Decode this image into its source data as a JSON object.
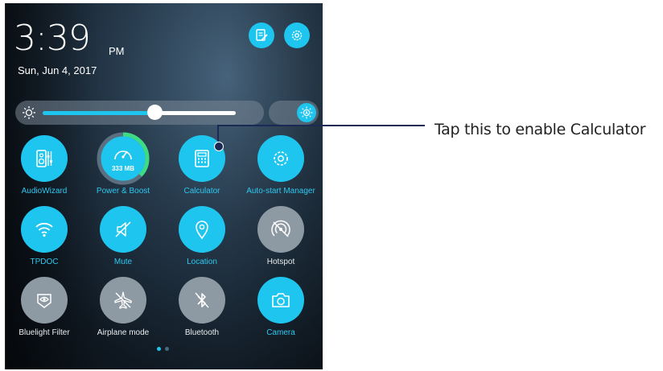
{
  "status": {
    "time": "3:39",
    "ampm": "PM",
    "date": "Sun, Jun 4, 2017"
  },
  "top_buttons": [
    {
      "name": "edit-notes-icon"
    },
    {
      "name": "settings-gear-icon"
    }
  ],
  "brightness": {
    "level": 0.58,
    "auto_icon": "auto-brightness-icon",
    "icon": "sun-icon"
  },
  "tiles": [
    {
      "label": "AudioWizard",
      "active": true,
      "icon": "audiowizard-icon"
    },
    {
      "label": "Power & Boost",
      "active": true,
      "icon": "speedometer-icon",
      "badge": "333 MB"
    },
    {
      "label": "Calculator",
      "active": true,
      "icon": "calculator-icon"
    },
    {
      "label": "Auto-start Manager",
      "active": true,
      "icon": "gear-icon"
    },
    {
      "label": "TPDOC",
      "active": true,
      "icon": "wifi-icon"
    },
    {
      "label": "Mute",
      "active": true,
      "icon": "mute-icon"
    },
    {
      "label": "Location",
      "active": true,
      "icon": "location-pin-icon"
    },
    {
      "label": "Hotspot",
      "active": false,
      "icon": "hotspot-icon"
    },
    {
      "label": "Bluelight Filter",
      "active": false,
      "icon": "eye-icon"
    },
    {
      "label": "Airplane mode",
      "active": false,
      "icon": "airplane-icon"
    },
    {
      "label": "Bluetooth",
      "active": false,
      "icon": "bluetooth-icon"
    },
    {
      "label": "Camera",
      "active": true,
      "icon": "camera-icon"
    }
  ],
  "pager": {
    "pages": 2,
    "current": 1
  },
  "callout": {
    "text": "Tap this to enable Calculator"
  },
  "colors": {
    "accent": "#1ec5ee",
    "inactive": "#8e9aa3",
    "callout": "#1b2a55"
  }
}
